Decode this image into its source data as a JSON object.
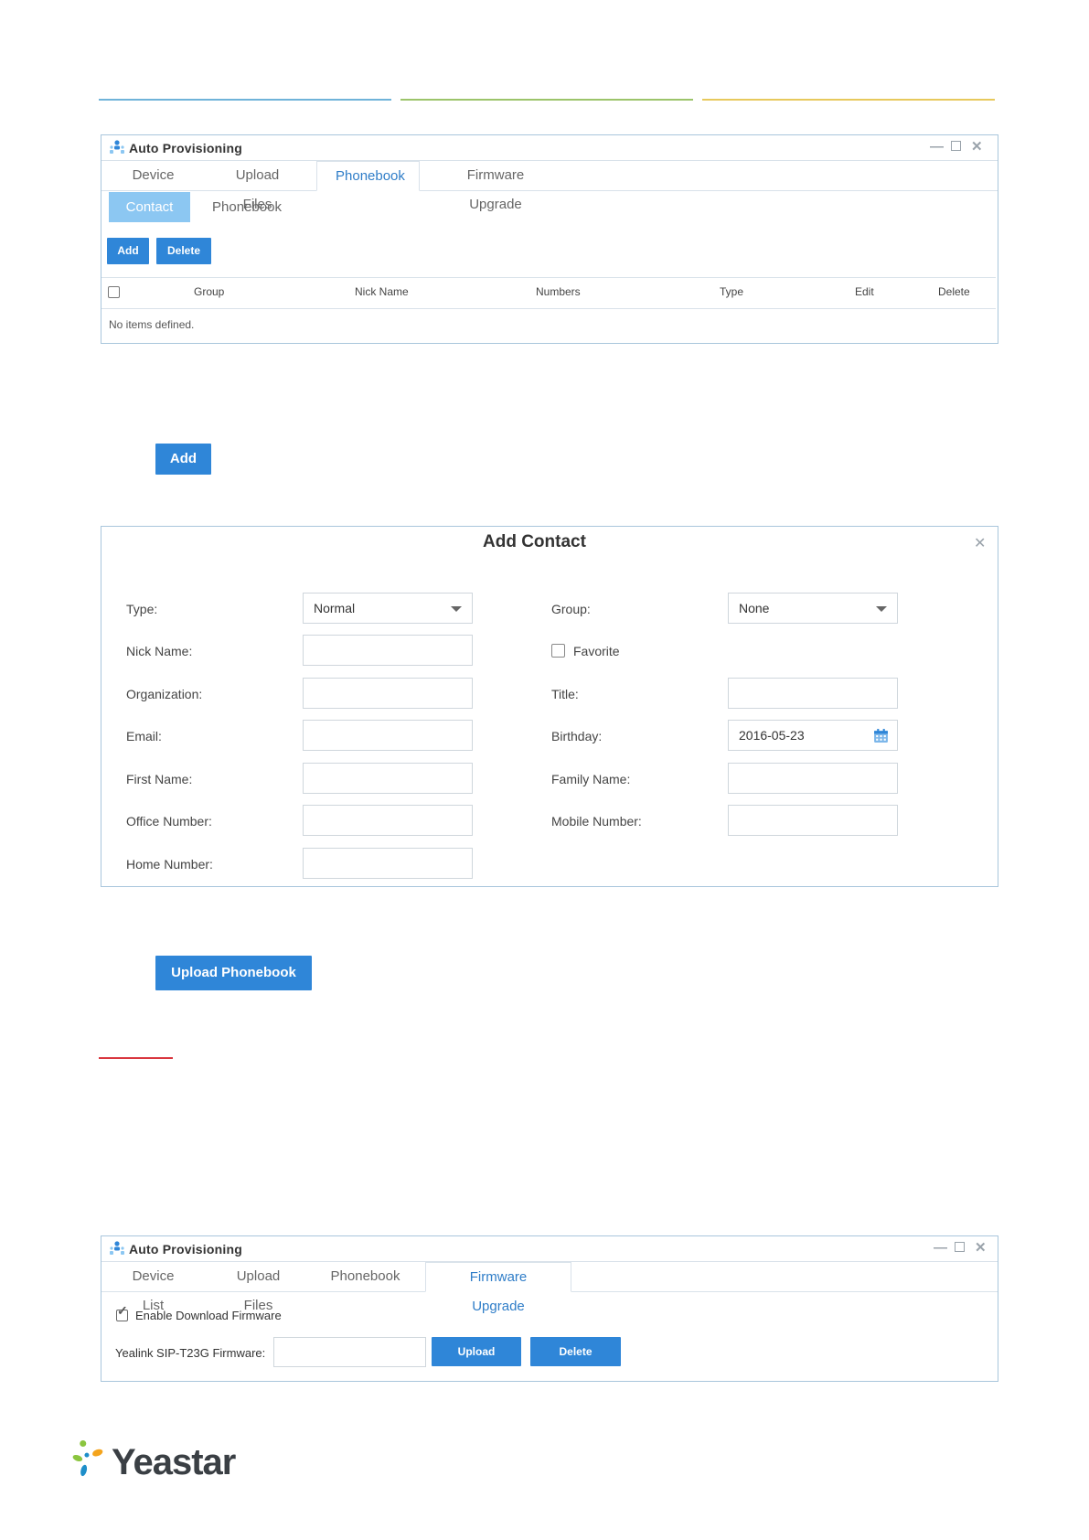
{
  "colors": {
    "accent": "#2f86d8",
    "tab_active": "#2f7dc8",
    "subtab_active": "#8cc7f2",
    "logo_text": "#3a3f44"
  },
  "panel1": {
    "title": "Auto Provisioning",
    "tabs": [
      "Device List",
      "Upload Files",
      "Phonebook",
      "Firmware Upgrade"
    ],
    "subtabs": [
      "Contact",
      "Phonebook"
    ],
    "add_label": "Add",
    "delete_label": "Delete",
    "columns": [
      "Group",
      "Nick Name",
      "Numbers",
      "Type",
      "Edit",
      "Delete"
    ],
    "empty_text": "No items defined."
  },
  "add_button_label": "Add",
  "dialog": {
    "title": "Add Contact",
    "type_label": "Type:",
    "type_value": "Normal",
    "group_label": "Group:",
    "group_value": "None",
    "nick_name_label": "Nick Name:",
    "favorite_label": "Favorite",
    "organization_label": "Organization:",
    "title_label": "Title:",
    "email_label": "Email:",
    "birthday_label": "Birthday:",
    "birthday_value": "2016-05-23",
    "first_name_label": "First Name:",
    "family_name_label": "Family Name:",
    "office_number_label": "Office Number:",
    "mobile_number_label": "Mobile Number:",
    "home_number_label": "Home Number:"
  },
  "upload_phonebook_label": "Upload Phonebook",
  "panel2": {
    "title": "Auto Provisioning",
    "tabs": [
      "Device List",
      "Upload Files",
      "Phonebook",
      "Firmware Upgrade"
    ],
    "enable_download_label": "Enable Download Firmware",
    "firmware_label": "Yealink SIP-T23G Firmware:",
    "upload_label": "Upload",
    "delete_label": "Delete"
  },
  "logo_text": "Yeastar",
  "icons": [
    "app-users-icon",
    "minimize-icon",
    "maximize-icon",
    "close-icon",
    "dropdown-caret-icon",
    "calendar-icon",
    "checkbox-checked-icon",
    "yeastar-logo-icon"
  ]
}
